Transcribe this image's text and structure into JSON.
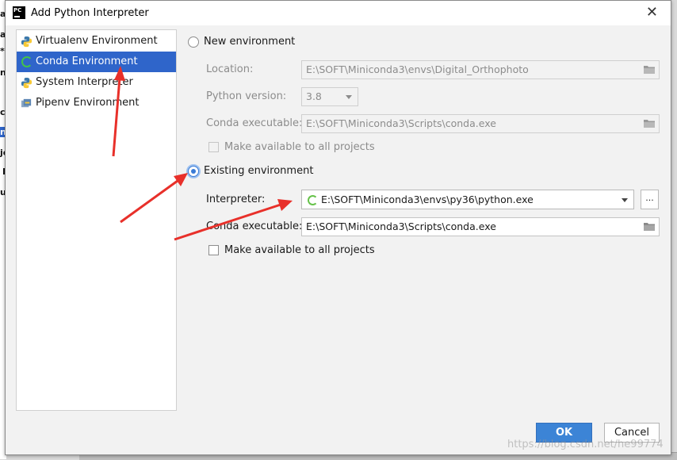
{
  "background": {
    "fragments": [
      "ar",
      "a",
      "*",
      "ns",
      "ct",
      "nc",
      "je",
      "E",
      "ua"
    ]
  },
  "dialog": {
    "title": "Add Python Interpreter",
    "app_icon_text": "PC"
  },
  "env_list": [
    {
      "label": "Virtualenv Environment",
      "icon": "python-icon",
      "selected": false
    },
    {
      "label": "Conda Environment",
      "icon": "conda-icon",
      "selected": true
    },
    {
      "label": "System Interpreter",
      "icon": "python-icon",
      "selected": false
    },
    {
      "label": "Pipenv Environment",
      "icon": "pipenv-icon",
      "selected": false
    }
  ],
  "new_env": {
    "radio_label": "New environment",
    "checked": false,
    "location_label": "Location:",
    "location_value": "E:\\SOFT\\Miniconda3\\envs\\Digital_Orthophoto",
    "python_version_label": "Python version:",
    "python_version_value": "3.8",
    "conda_exec_label": "Conda executable:",
    "conda_exec_value": "E:\\SOFT\\Miniconda3\\Scripts\\conda.exe",
    "make_available_label": "Make available to all projects"
  },
  "existing_env": {
    "radio_label": "Existing environment",
    "checked": true,
    "interpreter_label": "Interpreter:",
    "interpreter_value": "E:\\SOFT\\Miniconda3\\envs\\py36\\python.exe",
    "browse_label": "...",
    "conda_exec_label": "Conda executable:",
    "conda_exec_value": "E:\\SOFT\\Miniconda3\\Scripts\\conda.exe",
    "make_available_label": "Make available to all projects"
  },
  "buttons": {
    "ok": "OK",
    "cancel": "Cancel"
  },
  "watermark": "https://blog.csdn.net/he99774",
  "colors": {
    "selection": "#2f65ca",
    "ok_button": "#3c84d6",
    "annotation_arrow": "#e8302a"
  }
}
